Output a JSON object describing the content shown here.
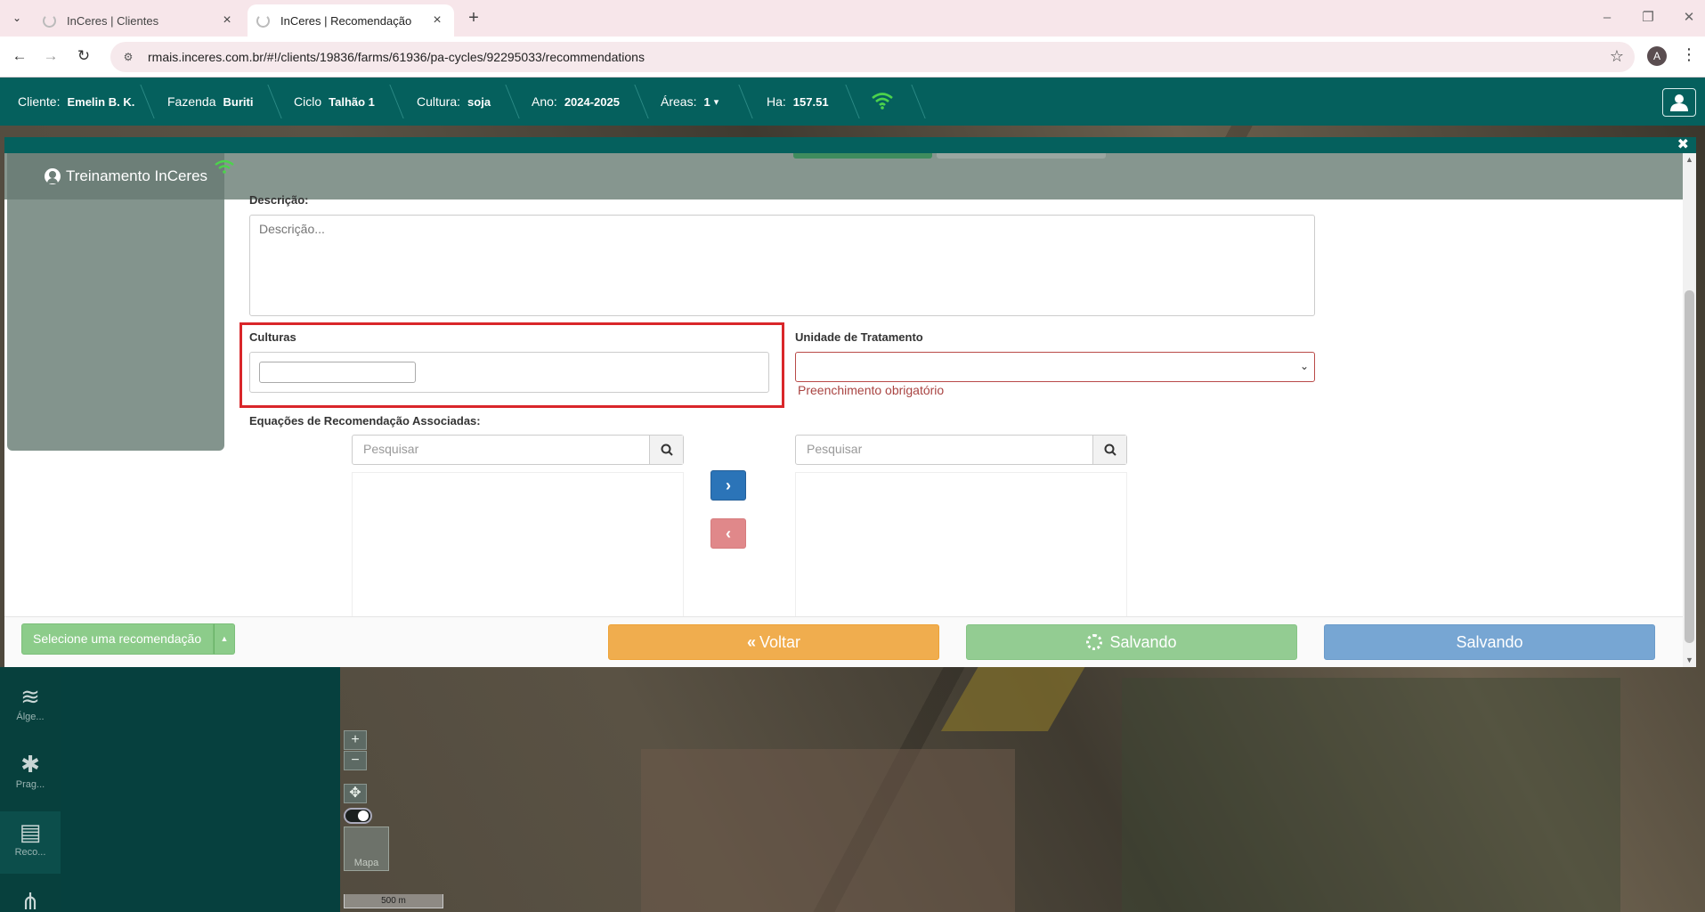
{
  "browser": {
    "tabs": [
      {
        "title": "InCeres | Clientes",
        "active": false
      },
      {
        "title": "InCeres | Recomendação",
        "active": true
      }
    ],
    "url": "rmais.inceres.com.br/#!/clients/19836/farms/61936/pa-cycles/92295033/recommendations",
    "profile_initial": "A"
  },
  "header": {
    "cliente_label": "Cliente:",
    "cliente_value": "Emelin B. K.",
    "fazenda_label": "Fazenda",
    "fazenda_value": "Buriti",
    "ciclo_label": "Ciclo",
    "ciclo_value": "Talhão 1",
    "cultura_label": "Cultura:",
    "cultura_value": "soja",
    "ano_label": "Ano:",
    "ano_value": "2024-2025",
    "areas_label": "Áreas:",
    "areas_value": "1",
    "ha_label": "Ha:",
    "ha_value": "157.51",
    "accent_color": "#05605d"
  },
  "user_card": {
    "name": "Treinamento InCeres"
  },
  "form": {
    "descricao_label": "Descrição:",
    "descricao_placeholder": "Descrição...",
    "culturas_label": "Culturas",
    "unidade_label": "Unidade de Tratamento",
    "unidade_error": "Preenchimento obrigatório",
    "equacoes_label": "Equações de Recomendação Associadas:",
    "search_left_placeholder": "Pesquisar",
    "search_right_placeholder": "Pesquisar"
  },
  "footer": {
    "select_recommendation": "Selecione uma recomendação",
    "voltar": "Voltar",
    "salvando_1": "Salvando",
    "salvando_2": "Salvando"
  },
  "map": {
    "rail": [
      {
        "label": "Álge...",
        "icon": "layers-icon"
      },
      {
        "label": "Prag...",
        "icon": "bug-icon"
      },
      {
        "label": "Reco...",
        "icon": "recommendation-icon"
      }
    ],
    "mapa_label": "Mapa",
    "scale_label": "500 m"
  }
}
